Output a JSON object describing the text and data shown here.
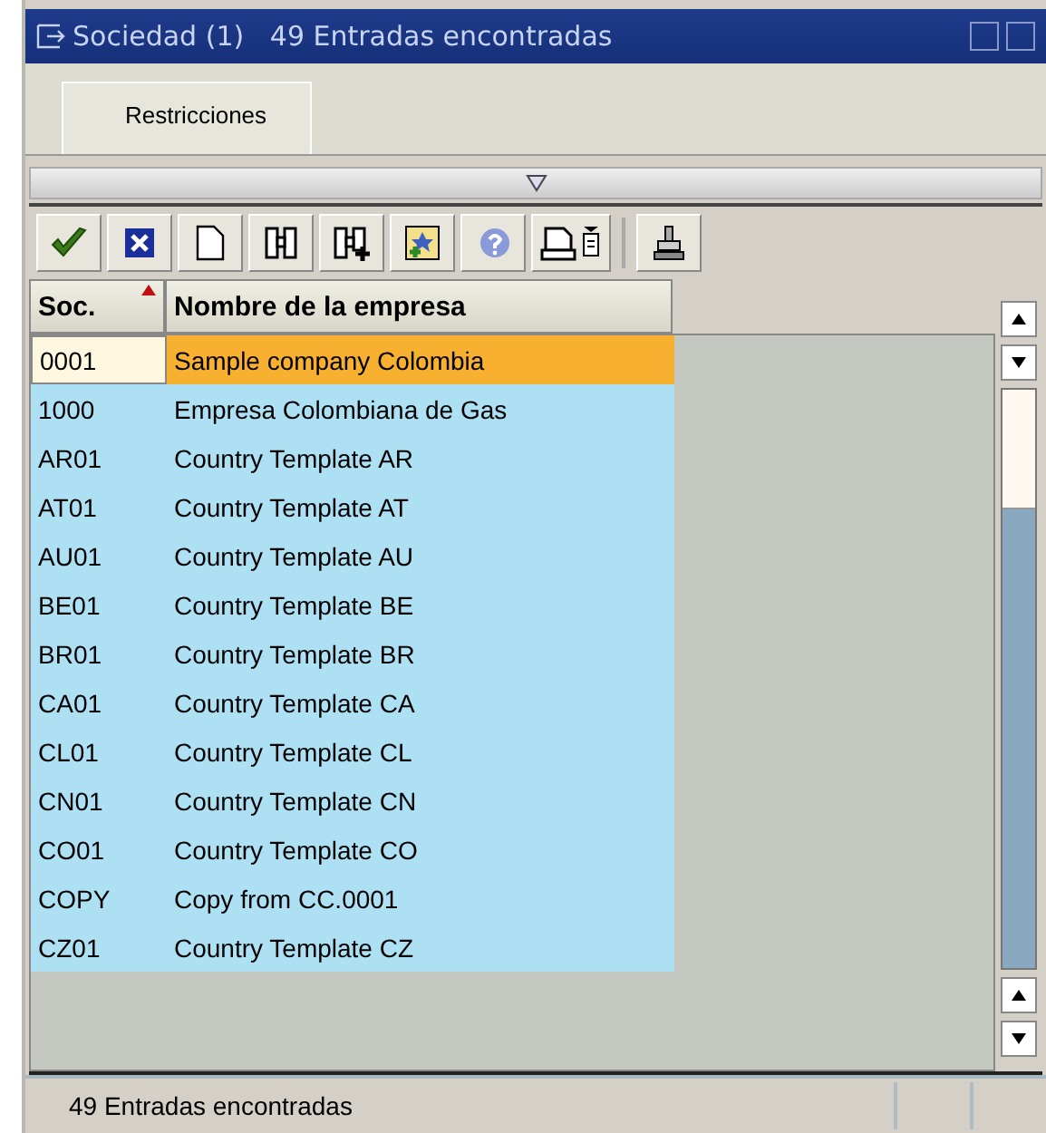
{
  "window": {
    "title": "Sociedad (1)   49 Entradas encontradas"
  },
  "tabs": [
    {
      "label": "Restricciones",
      "selected": true
    }
  ],
  "toolbar": [
    {
      "kind": "check"
    },
    {
      "kind": "cancel"
    },
    {
      "kind": "new"
    },
    {
      "kind": "find"
    },
    {
      "kind": "findnext"
    },
    {
      "kind": "insert"
    },
    {
      "kind": "help"
    },
    {
      "kind": "print"
    },
    {
      "kind": "sep"
    },
    {
      "kind": "pin"
    }
  ],
  "table": {
    "columns": [
      {
        "label": "Soc.",
        "sorted": true
      },
      {
        "label": "Nombre de la empresa",
        "sorted": false
      }
    ],
    "rows": [
      {
        "code": "0001",
        "name": "Sample company Colombia",
        "selected": true
      },
      {
        "code": "1000",
        "name": "Empresa Colombiana de Gas",
        "selected": false
      },
      {
        "code": "AR01",
        "name": "Country Template AR",
        "selected": false
      },
      {
        "code": "AT01",
        "name": "Country Template AT",
        "selected": false
      },
      {
        "code": "AU01",
        "name": "Country Template AU",
        "selected": false
      },
      {
        "code": "BE01",
        "name": "Country Template BE",
        "selected": false
      },
      {
        "code": "BR01",
        "name": "Country Template BR",
        "selected": false
      },
      {
        "code": "CA01",
        "name": "Country Template CA",
        "selected": false
      },
      {
        "code": "CL01",
        "name": "Country Template CL",
        "selected": false
      },
      {
        "code": "CN01",
        "name": "Country Template CN",
        "selected": false
      },
      {
        "code": "CO01",
        "name": "Country Template CO",
        "selected": false
      },
      {
        "code": "COPY",
        "name": "Copy from CC.0001",
        "selected": false
      },
      {
        "code": "CZ01",
        "name": "Country Template CZ",
        "selected": false
      }
    ]
  },
  "status_bar": {
    "text": "49 Entradas encontradas"
  }
}
